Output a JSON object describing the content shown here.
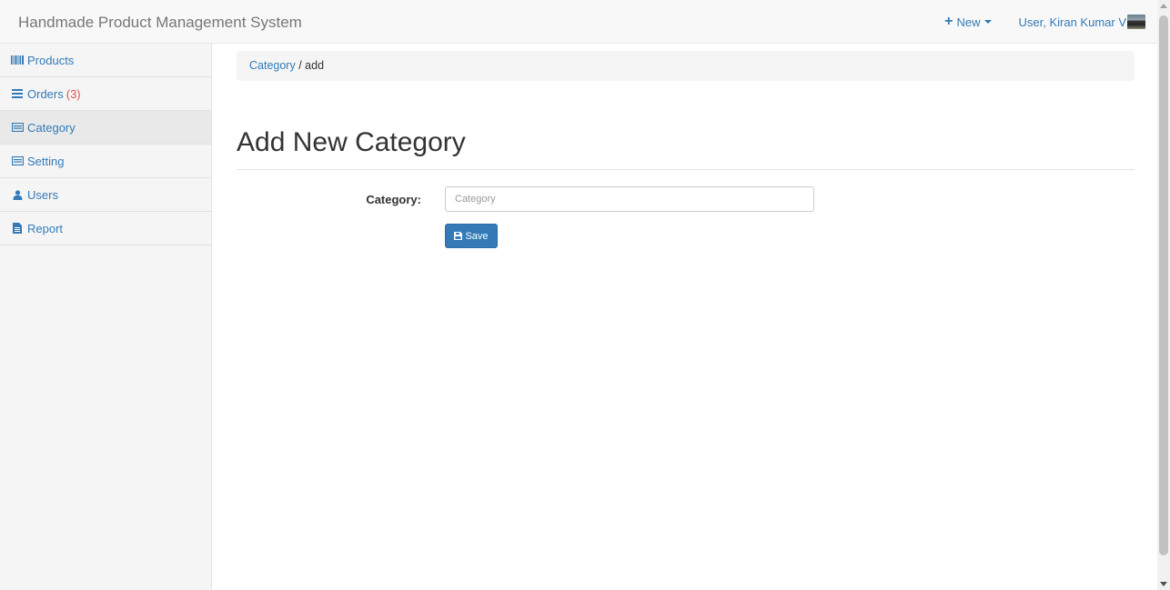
{
  "app": {
    "title": "Handmade Product Management System"
  },
  "nav": {
    "new_label": "New",
    "user_label": "User, Kiran Kumar V"
  },
  "sidebar": {
    "items": [
      {
        "label": "Products",
        "icon": "barcode-icon"
      },
      {
        "label": "Orders",
        "count": "(3)",
        "icon": "list-icon"
      },
      {
        "label": "Category",
        "icon": "card-icon",
        "active": true
      },
      {
        "label": "Setting",
        "icon": "card-icon"
      },
      {
        "label": "Users",
        "icon": "user-icon"
      },
      {
        "label": "Report",
        "icon": "file-icon"
      }
    ]
  },
  "breadcrumb": {
    "link": "Category",
    "current": "add",
    "separator": "/"
  },
  "page": {
    "title": "Add New Category"
  },
  "form": {
    "category_label": "Category:",
    "category_placeholder": "Category",
    "category_value": "",
    "save_label": "Save"
  },
  "colors": {
    "link": "#337ab7",
    "badge": "#d9534f",
    "primary": "#337ab7"
  }
}
